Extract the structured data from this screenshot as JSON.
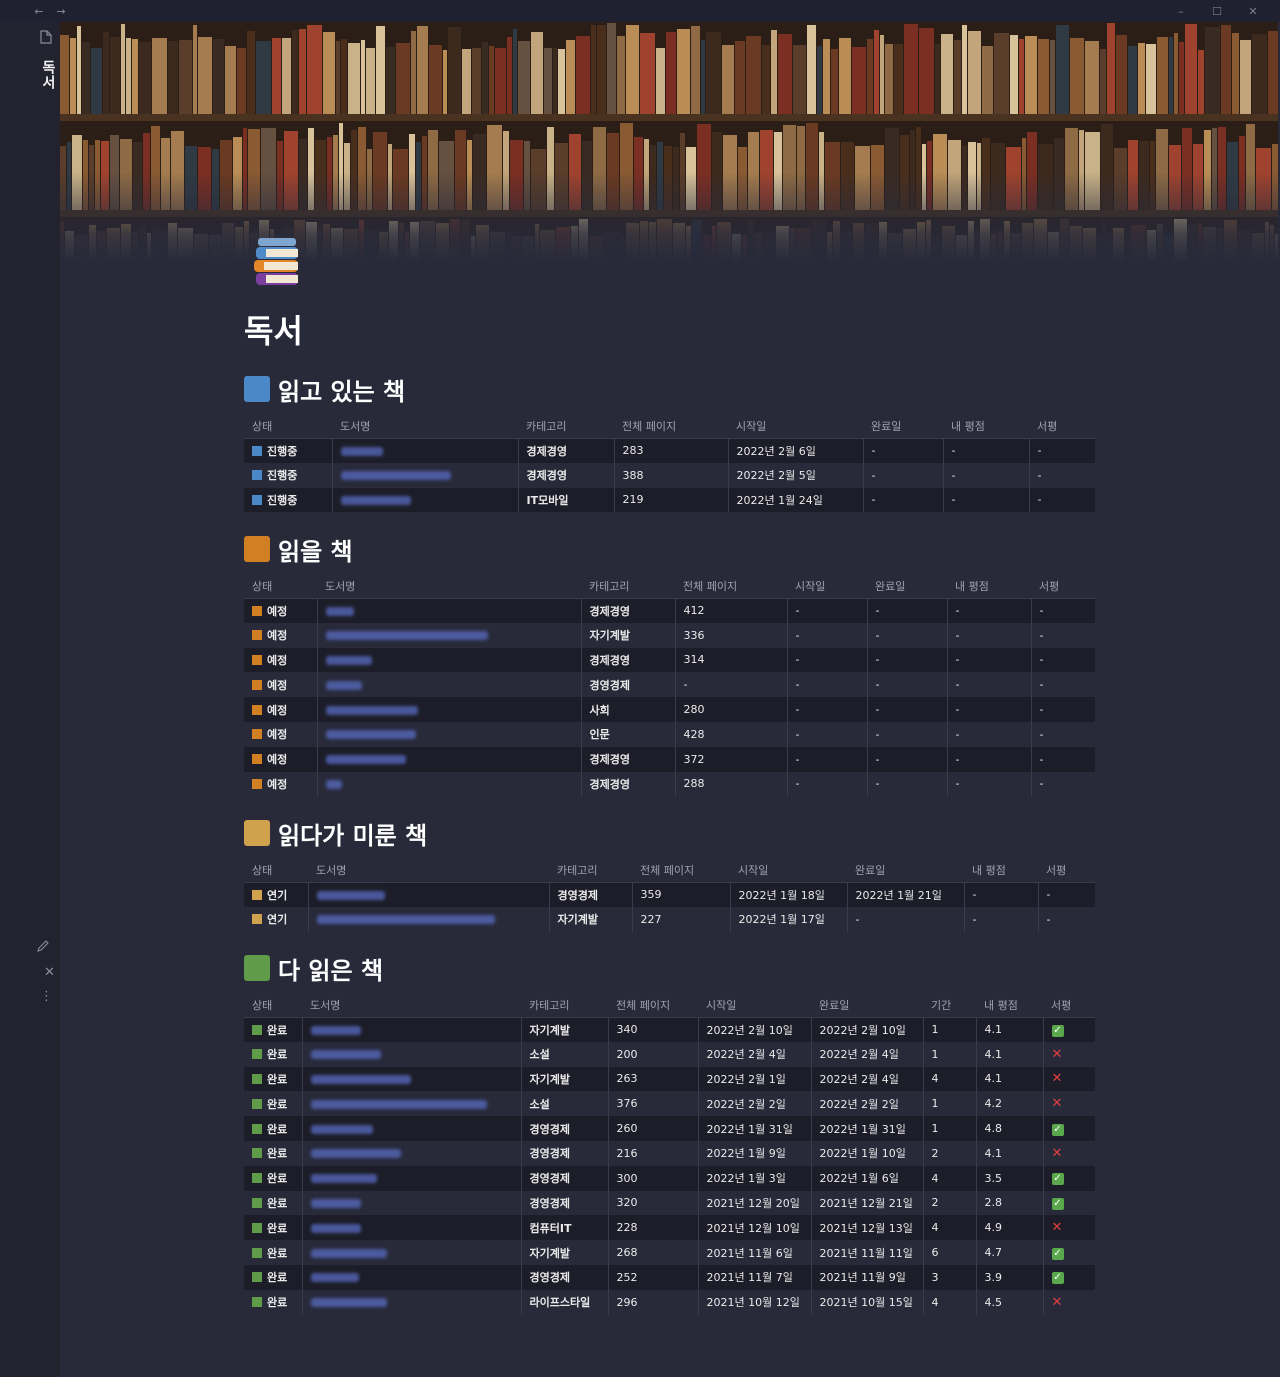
{
  "window": {
    "back": "←",
    "forward": "→",
    "minimize": "–",
    "maximize": "☐",
    "close": "✕"
  },
  "sidebar": {
    "title": "독서"
  },
  "page": {
    "title": "독서"
  },
  "columns_label": {
    "status": "상태",
    "name": "도서명",
    "category": "카테고리",
    "pages": "전체 페이지",
    "start": "시작일",
    "end": "완료일",
    "duration": "기간",
    "rating": "내 평점",
    "review": "서평"
  },
  "colors": {
    "reading": "#4a88c8",
    "toread": "#d07f22",
    "paused": "#d1a24e",
    "done": "#5f9b48"
  },
  "sections": [
    {
      "title": "읽고 있는 책",
      "color": "#4a88c8",
      "rows": [
        {
          "status": "진행중",
          "category": "경제경영",
          "pages": "283",
          "start": "2022년 2월 6일",
          "end": "-",
          "rating": "-",
          "review": "-"
        },
        {
          "status": "진행중",
          "category": "경제경영",
          "pages": "388",
          "start": "2022년 2월 5일",
          "end": "-",
          "rating": "-",
          "review": "-"
        },
        {
          "status": "진행중",
          "category": "IT모바일",
          "pages": "219",
          "start": "2022년 1월 24일",
          "end": "-",
          "rating": "-",
          "review": "-"
        }
      ]
    },
    {
      "title": "읽을 책",
      "color": "#d07f22",
      "rows": [
        {
          "status": "예정",
          "category": "경제경영",
          "pages": "412",
          "start": "-",
          "end": "-",
          "rating": "-",
          "review": "-"
        },
        {
          "status": "예정",
          "category": "자기계발",
          "pages": "336",
          "start": "-",
          "end": "-",
          "rating": "-",
          "review": "-"
        },
        {
          "status": "예정",
          "category": "경제경영",
          "pages": "314",
          "start": "-",
          "end": "-",
          "rating": "-",
          "review": "-"
        },
        {
          "status": "예정",
          "category": "경영경제",
          "pages": "-",
          "start": "-",
          "end": "-",
          "rating": "-",
          "review": "-"
        },
        {
          "status": "예정",
          "category": "사회",
          "pages": "280",
          "start": "-",
          "end": "-",
          "rating": "-",
          "review": "-"
        },
        {
          "status": "예정",
          "category": "인문",
          "pages": "428",
          "start": "-",
          "end": "-",
          "rating": "-",
          "review": "-"
        },
        {
          "status": "예정",
          "category": "경제경영",
          "pages": "372",
          "start": "-",
          "end": "-",
          "rating": "-",
          "review": "-"
        },
        {
          "status": "예정",
          "category": "경제경영",
          "pages": "288",
          "start": "-",
          "end": "-",
          "rating": "-",
          "review": "-"
        }
      ]
    },
    {
      "title": "읽다가 미룬 책",
      "color": "#d1a24e",
      "rows": [
        {
          "status": "연기",
          "category": "경영경제",
          "pages": "359",
          "start": "2022년 1월 18일",
          "end": "2022년 1월 21일",
          "rating": "-",
          "review": "-"
        },
        {
          "status": "연기",
          "category": "자기계발",
          "pages": "227",
          "start": "2022년 1월 17일",
          "end": "-",
          "rating": "-",
          "review": "-"
        }
      ]
    },
    {
      "title": "다 읽은 책",
      "color": "#5f9b48",
      "rows": [
        {
          "status": "완료",
          "category": "자기계발",
          "pages": "340",
          "start": "2022년 2월 10일",
          "end": "2022년 2월 10일",
          "duration": "1",
          "rating": "4.1",
          "review": true
        },
        {
          "status": "완료",
          "category": "소설",
          "pages": "200",
          "start": "2022년 2월 4일",
          "end": "2022년 2월 4일",
          "duration": "1",
          "rating": "4.1",
          "review": false
        },
        {
          "status": "완료",
          "category": "자기계발",
          "pages": "263",
          "start": "2022년 2월 1일",
          "end": "2022년 2월 4일",
          "duration": "4",
          "rating": "4.1",
          "review": false
        },
        {
          "status": "완료",
          "category": "소설",
          "pages": "376",
          "start": "2022년 2월 2일",
          "end": "2022년 2월 2일",
          "duration": "1",
          "rating": "4.2",
          "review": false
        },
        {
          "status": "완료",
          "category": "경영경제",
          "pages": "260",
          "start": "2022년 1월 31일",
          "end": "2022년 1월 31일",
          "duration": "1",
          "rating": "4.8",
          "review": true
        },
        {
          "status": "완료",
          "category": "경영경제",
          "pages": "216",
          "start": "2022년 1월 9일",
          "end": "2022년 1월 10일",
          "duration": "2",
          "rating": "4.1",
          "review": false
        },
        {
          "status": "완료",
          "category": "경영경제",
          "pages": "300",
          "start": "2022년 1월 3일",
          "end": "2022년 1월 6일",
          "duration": "4",
          "rating": "3.5",
          "review": true
        },
        {
          "status": "완료",
          "category": "경영경제",
          "pages": "320",
          "start": "2021년 12월 20일",
          "end": "2021년 12월 21일",
          "duration": "2",
          "rating": "2.8",
          "review": true
        },
        {
          "status": "완료",
          "category": "컴퓨터IT",
          "pages": "228",
          "start": "2021년 12월 10일",
          "end": "2021년 12월 13일",
          "duration": "4",
          "rating": "4.9",
          "review": false
        },
        {
          "status": "완료",
          "category": "자기계발",
          "pages": "268",
          "start": "2021년 11월 6일",
          "end": "2021년 11월 11일",
          "duration": "6",
          "rating": "4.7",
          "review": true
        },
        {
          "status": "완료",
          "category": "경영경제",
          "pages": "252",
          "start": "2021년 11월 7일",
          "end": "2021년 11월 9일",
          "duration": "3",
          "rating": "3.9",
          "review": true
        },
        {
          "status": "완료",
          "category": "라이프스타일",
          "pages": "296",
          "start": "2021년 10월 12일",
          "end": "2021년 10월 15일",
          "duration": "4",
          "rating": "4.5",
          "review": false
        }
      ]
    }
  ],
  "icons": {
    "doc": "page-icon",
    "edit": "pencil-icon",
    "close": "close-icon",
    "more": "more-vertical-icon",
    "review_yes": "✓",
    "review_no": "✕"
  }
}
